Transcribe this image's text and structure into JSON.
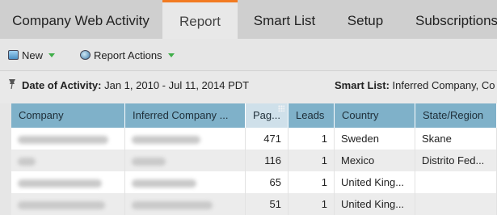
{
  "tabs": [
    {
      "label": "Company Web Activity",
      "active": false
    },
    {
      "label": "Report",
      "active": true
    },
    {
      "label": "Smart List",
      "active": false
    },
    {
      "label": "Setup",
      "active": false
    },
    {
      "label": "Subscriptions",
      "active": false
    }
  ],
  "toolbar": {
    "new_label": "New",
    "report_actions_label": "Report Actions"
  },
  "filters": {
    "date_label": "Date of Activity:",
    "date_value": "Jan 1, 2010 - Jul 11, 2014 PDT",
    "smartlist_label": "Smart List:",
    "smartlist_value": "Inferred Company, Co"
  },
  "table": {
    "columns": [
      "Company",
      "Inferred Company ...",
      "Pag...",
      "Leads",
      "Country",
      "State/Region"
    ],
    "rows": [
      {
        "pages": "471",
        "leads": "1",
        "country": "Sweden",
        "state": "Skane"
      },
      {
        "pages": "116",
        "leads": "1",
        "country": "Mexico",
        "state": "Distrito Fed..."
      },
      {
        "pages": "65",
        "leads": "1",
        "country": "United King...",
        "state": ""
      },
      {
        "pages": "51",
        "leads": "1",
        "country": "United King...",
        "state": ""
      }
    ]
  },
  "colors": {
    "active_tab_accent": "#f27a21",
    "header_bg": "#7fb1c9"
  }
}
